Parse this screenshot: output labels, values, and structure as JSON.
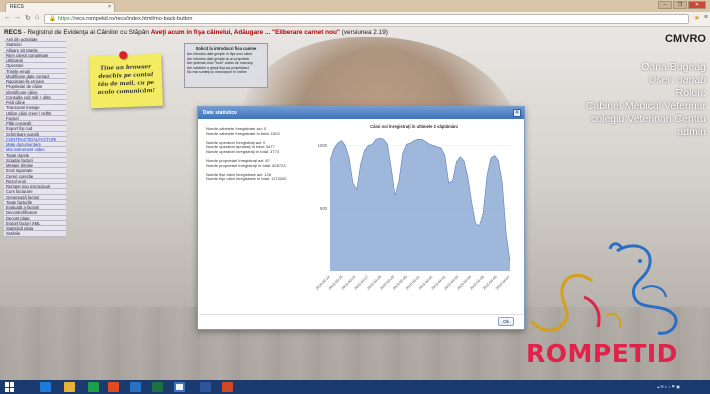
{
  "browser": {
    "tab_title": "RECS",
    "tab_close": "×",
    "url_prefix": "https://",
    "url_rest": "recs.rompetid.ro/recs/index.html#no-back-button",
    "win_min": "–",
    "win_max": "❐",
    "win_close": "✕"
  },
  "header": {
    "brand": "RECS",
    "part1": " - Registrul de Evidenţa ai Câinilor cu Stăpân ",
    "highlight": "Aveţi acum in fişa câinelui, Adăugare ... \"Eliberare carnet nou\"",
    "part2": " (versiunea 2.19)"
  },
  "sidebar": {
    "items": [
      {
        "label": "Anii din activitate"
      },
      {
        "label": "Statistici"
      },
      {
        "label": "Afisare Sit Martie"
      },
      {
        "label": "Rem citesti completate"
      },
      {
        "label": "Utilizatori"
      },
      {
        "label": "Operatori"
      },
      {
        "label": "Trimite email"
      },
      {
        "label": "Modificare date contact"
      },
      {
        "label": "Raportare-fa erroare"
      },
      {
        "label": "Proprietari de câine"
      },
      {
        "label": "Identificare câine"
      },
      {
        "label": "Consulta cod mib + dlss"
      },
      {
        "label": "Fişă câine"
      },
      {
        "label": "Tranzacwi mesaje"
      },
      {
        "label": "Utilize câini creer / Hdhh"
      },
      {
        "label": "Facturi"
      },
      {
        "label": "Plăti cerutedit"
      },
      {
        "label": "Export fişi cod"
      },
      {
        "label": "Schimbare parolă"
      },
      {
        "label": "CONTRACTE/ALFACTURI",
        "active": true
      },
      {
        "label": "Mate documentare",
        "active": true
      },
      {
        "label": "Mai instrument video",
        "active": true
      },
      {
        "label": "Toate durele"
      },
      {
        "label": "Sciadar facturi"
      },
      {
        "label": "Mesaje trimise"
      },
      {
        "label": "Eroti raportate"
      },
      {
        "label": "Cereri corectie"
      },
      {
        "label": "Rezol erori"
      },
      {
        "label": "Rompet nou microcipuri"
      },
      {
        "label": "Curs facturare"
      },
      {
        "label": "Generează factori"
      },
      {
        "label": "Toate facturile"
      },
      {
        "label": "Evaluată a factorii"
      },
      {
        "label": "Decontrolificaton"
      },
      {
        "label": "Decont plata"
      },
      {
        "label": "Export factori XML"
      },
      {
        "label": "Statistică plata"
      },
      {
        "label": "Setările"
      }
    ]
  },
  "sticky_note": {
    "lines": [
      "Tine un browser",
      "deschis pe contul",
      "tău de mail, cu pe",
      "acolo comunicăm!"
    ]
  },
  "info_box": {
    "title": "Solicit la introducri fisa canine",
    "rows": [
      "Am introdus date greşite în fişa unui câine",
      "Am introdus date greşite la un proprietar",
      "Am şelemat cinci \"fond\" codes de microcip",
      "Am salvineri a greşit fişa ica proprietarul",
      "Nu mai sunteţi cu microcipuri în ordine"
    ]
  },
  "user_panel": {
    "org": "CMVRO",
    "name": "Oana Bugeag",
    "user_label": "User: ",
    "username": "oanab",
    "roles_label": "Roluri:",
    "role1": "Cabinet Medical Veterinar",
    "role2": "colegiu Veterinari Centru",
    "role3": "admin"
  },
  "logo": {
    "text": "ROMPETID"
  },
  "modal": {
    "title": "Date statistice",
    "close": "×",
    "stats": [
      [
        "Număr cabinete înregistrate azi: 0",
        "Număr cabinete înregistrate în total: 1923"
      ],
      [
        "Număr operatori înregistraţi azi: 0",
        "Număr operatori aprobaţi în total: 3477",
        "Număr operatori înregistraţi în total: 3773"
      ],
      [
        "Număr proprietari înregistraţi azi: 87",
        "Număr proprietari înregistraţi în total: 825723"
      ],
      [
        "Număr fişe câini înregistrate azi: 126",
        "Număr fişe câini înregistrate în total: 1173200"
      ]
    ],
    "ok_label": "Ok"
  },
  "chart_data": {
    "type": "area",
    "title": "Câini noi înregistraţi în ultimele 2 săptămâni",
    "color": "#8eaad4",
    "ylim": [
      0,
      1100
    ],
    "yticks": [
      500,
      1000
    ],
    "x": [
      "2015-03-24",
      "2015-03-25",
      "2015-03-26",
      "2015-03-27",
      "2015-03-28",
      "2015-03-29",
      "2015-03-30",
      "2015-03-31",
      "2015-04-01",
      "2015-04-02",
      "2015-04-03",
      "2015-04-04",
      "2015-04-05",
      "2015-04-06",
      "2015-04-07"
    ],
    "series": [
      {
        "values": [
          880,
          975,
          1020,
          1040,
          1000,
          900,
          700,
          650,
          850,
          960,
          1000,
          1010,
          1050,
          1060,
          1050,
          1010,
          820,
          600,
          720,
          940,
          1010,
          1020,
          1040,
          1050,
          1050,
          1030,
          1010,
          1000,
          990,
          980,
          920,
          700,
          720,
          870,
          910,
          880,
          750,
          550,
          380,
          360,
          460,
          760,
          900,
          920,
          880,
          700,
          300,
          80
        ]
      }
    ]
  }
}
